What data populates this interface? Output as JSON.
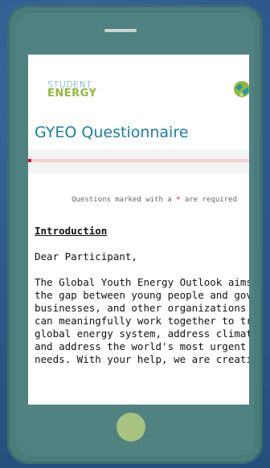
{
  "form": {
    "logo_line1": "STUDENT",
    "logo_line2": "ENERGY",
    "title": "GYEO Questionnaire",
    "progress_fraction": 0.0,
    "required_note_prefix": "Questions marked with a ",
    "required_star": "*",
    "required_note_suffix": " are required",
    "heading": "Introduction",
    "greeting": "Dear Participant,",
    "body_lines": [
      "The Global Youth Energy Outlook aims to",
      "the gap between young people and gover",
      "businesses, and other organizations so th",
      "can meaningfully work together to transf",
      "global energy system, address climate ch",
      "and address the world's most urgent ene",
      "needs. With your help, we are creating th"
    ]
  },
  "colors": {
    "background": "#2f5d91",
    "phone_body": "#4a7c7c",
    "home_button": "#a8c27f",
    "title_blue": "#1b7fa3",
    "logo_green": "#8fba3c",
    "required_red": "#d2112f"
  },
  "icons": {
    "logo": "student-energy-logo",
    "globe": "globe-icon",
    "home": "home-button"
  }
}
